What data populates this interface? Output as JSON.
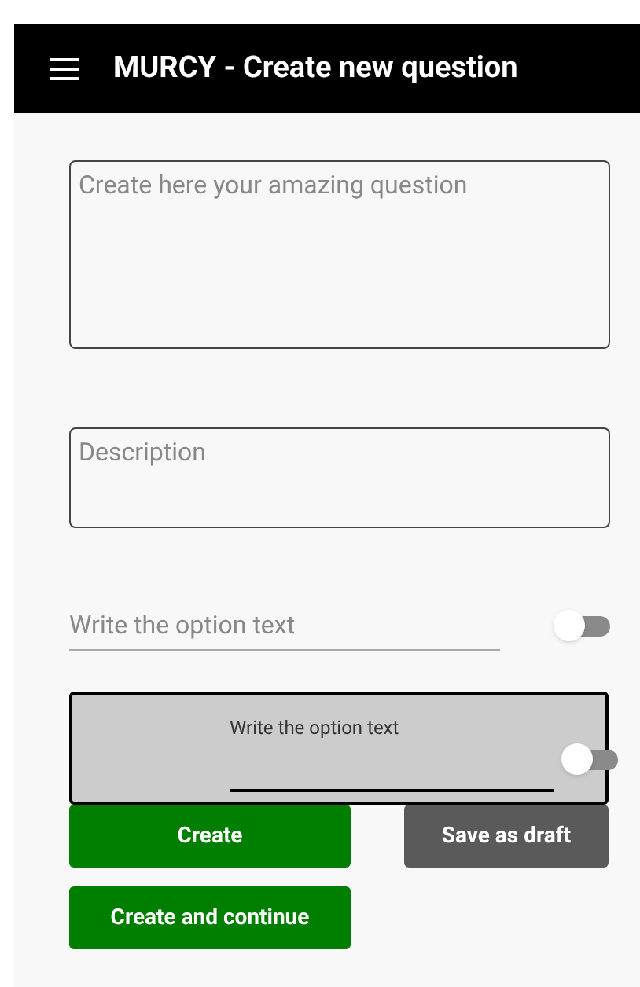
{
  "app_bar": {
    "title": "MURCY - Create new question"
  },
  "question": {
    "placeholder": "Create here your amazing question"
  },
  "description": {
    "placeholder": "Description"
  },
  "options": [
    {
      "kind": "plain",
      "placeholder": "Write the option text",
      "checked": false
    },
    {
      "kind": "card",
      "placeholder": "Write the option text",
      "checked": false
    }
  ],
  "buttons": [
    {
      "label": "Create",
      "kind": "primary"
    },
    {
      "label": "Save as draft",
      "kind": "secondary"
    },
    {
      "label": "Create and continue",
      "kind": "primary"
    }
  ]
}
